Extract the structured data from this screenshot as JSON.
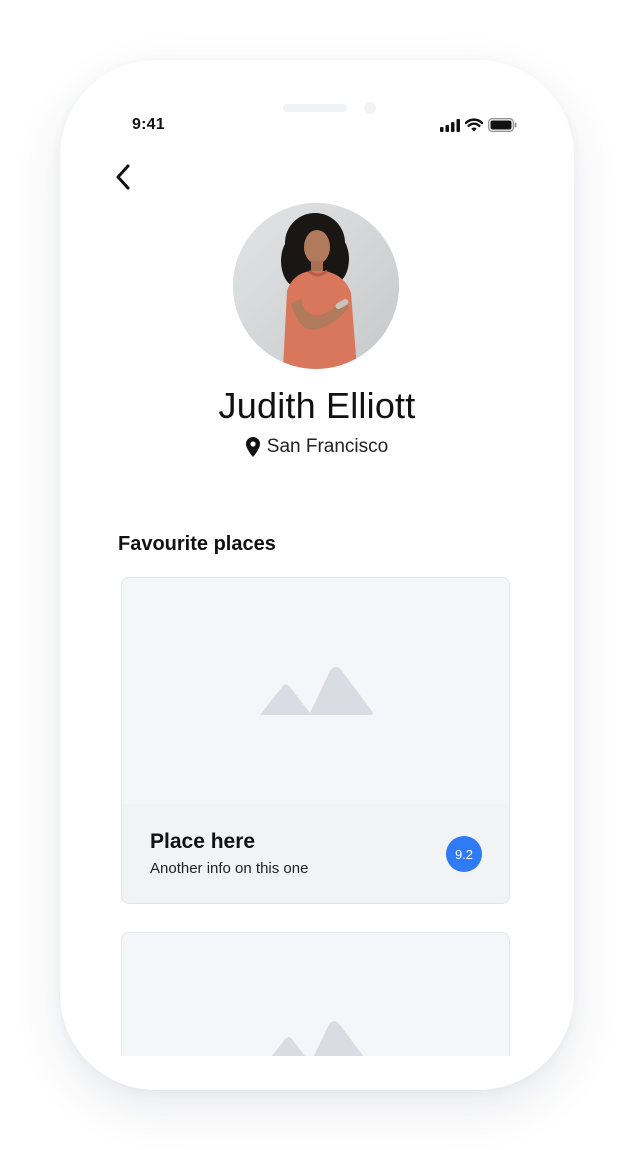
{
  "status_bar": {
    "time": "9:41",
    "icons": [
      "signal-icon",
      "wifi-icon",
      "battery-icon"
    ]
  },
  "navigation": {
    "back_icon": "chevron-left-icon"
  },
  "profile": {
    "name": "Judith Elliott",
    "location": "San Francisco",
    "location_icon": "map-pin-icon"
  },
  "favourites": {
    "title": "Favourite places",
    "places": [
      {
        "title": "Place here",
        "subtitle": "Another info on this one",
        "rating": "9.2"
      }
    ]
  },
  "colors": {
    "accent": "#2f7af5",
    "card_background": "#f5f6fa",
    "placeholder_icon": "#d9dde3"
  }
}
